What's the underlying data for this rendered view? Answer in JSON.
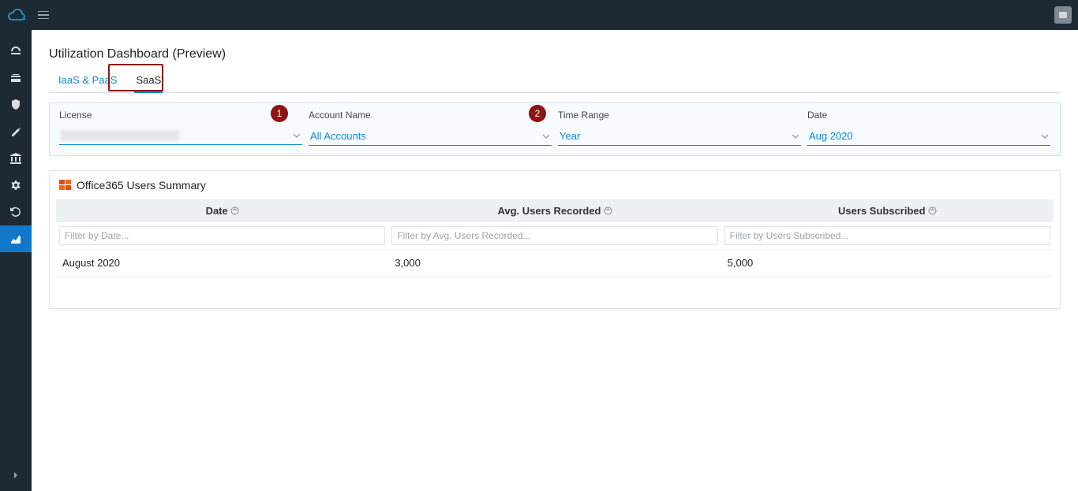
{
  "header": {
    "page_title": "Utilization Dashboard (Preview)"
  },
  "tabs": [
    {
      "id": "iaas-paas",
      "label": "IaaS & PaaS",
      "active": false
    },
    {
      "id": "saas",
      "label": "SaaS",
      "active": true
    }
  ],
  "callouts": [
    {
      "id": "1",
      "label": "1"
    },
    {
      "id": "2",
      "label": "2"
    }
  ],
  "filters": {
    "license": {
      "label": "License",
      "value": ""
    },
    "account_name": {
      "label": "Account Name",
      "value": "All Accounts"
    },
    "time_range": {
      "label": "Time Range",
      "value": "Year"
    },
    "date": {
      "label": "Date",
      "value": "Aug 2020"
    }
  },
  "card": {
    "title": "Office365 Users Summary",
    "columns": {
      "date": {
        "header": "Date",
        "filter_placeholder": "Filter by Date..."
      },
      "avg_users": {
        "header": "Avg. Users Recorded",
        "filter_placeholder": "Filter by Avg. Users Recorded..."
      },
      "users_subscribed": {
        "header": "Users Subscribed",
        "filter_placeholder": "Filter by Users Subscribed..."
      }
    },
    "rows": [
      {
        "date": "August 2020",
        "avg_users": "3,000",
        "users_subscribed": "5,000"
      }
    ]
  }
}
